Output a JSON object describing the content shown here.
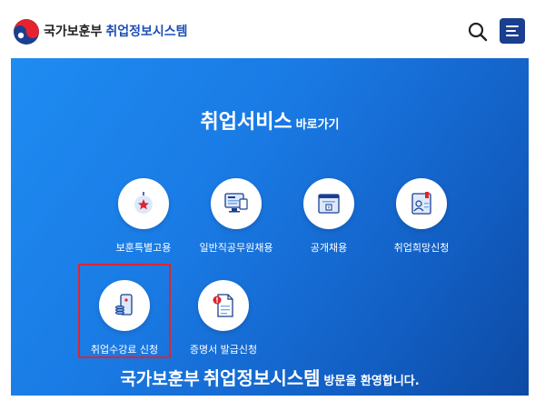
{
  "header": {
    "ministry": "국가보훈부",
    "system": "취업정보시스템"
  },
  "banner": {
    "title_main": "취업서비스",
    "title_sub": "바로가기",
    "welcome_ministry": "국가보훈부",
    "welcome_system": "취업정보시스템",
    "welcome_tail": "방문을 환영합니다."
  },
  "services": [
    {
      "label": "보훈특별고용",
      "icon": "bookmark-star-icon"
    },
    {
      "label": "일반직공무원채용",
      "icon": "monitor-icon"
    },
    {
      "label": "공개채용",
      "icon": "browser-window-icon"
    },
    {
      "label": "취업희망신청",
      "icon": "profile-card-icon"
    },
    {
      "label": "취업수강료 신청",
      "icon": "phone-coins-icon"
    },
    {
      "label": "증명서 발급신청",
      "icon": "document-alert-icon"
    }
  ],
  "colors": {
    "brand_blue": "#1f4fb5",
    "menu_bg": "#1a3f8f",
    "banner_start": "#1e8cf2",
    "banner_end": "#0d4aa4",
    "highlight": "#e0242e"
  }
}
